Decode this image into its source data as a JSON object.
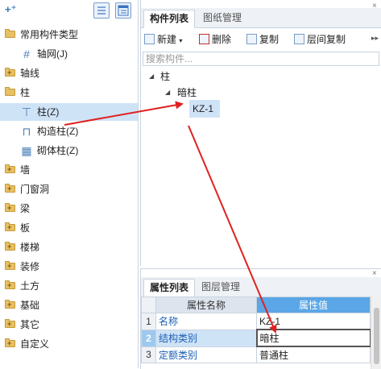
{
  "left_tree": {
    "items": [
      {
        "label": "常用构件类型",
        "kind": "folder",
        "expanded": true
      },
      {
        "label": "轴网(J)",
        "kind": "leaf",
        "icon": "grid-icon"
      },
      {
        "label": "轴线",
        "kind": "folder"
      },
      {
        "label": "柱",
        "kind": "folder",
        "expanded": true
      },
      {
        "label": "柱(Z)",
        "kind": "leaf",
        "icon": "column-icon",
        "selected": true
      },
      {
        "label": "构造柱(Z)",
        "kind": "leaf",
        "icon": "constructional-column-icon"
      },
      {
        "label": "砌体柱(Z)",
        "kind": "leaf",
        "icon": "masonry-column-icon"
      },
      {
        "label": "墙",
        "kind": "folder"
      },
      {
        "label": "门窗洞",
        "kind": "folder"
      },
      {
        "label": "梁",
        "kind": "folder"
      },
      {
        "label": "板",
        "kind": "folder"
      },
      {
        "label": "楼梯",
        "kind": "folder"
      },
      {
        "label": "装修",
        "kind": "folder"
      },
      {
        "label": "土方",
        "kind": "folder"
      },
      {
        "label": "基础",
        "kind": "folder"
      },
      {
        "label": "其它",
        "kind": "folder"
      },
      {
        "label": "自定义",
        "kind": "folder"
      }
    ]
  },
  "component_panel": {
    "tabs": [
      {
        "label": "构件列表"
      },
      {
        "label": "图纸管理"
      }
    ],
    "toolbar": {
      "new_label": "新建",
      "delete_label": "删除",
      "copy_label": "复制",
      "floor_copy_label": "层间复制"
    },
    "search_placeholder": "搜索构件...",
    "tree": {
      "root": "柱",
      "child": "暗柱",
      "leaf": "KZ-1"
    }
  },
  "property_panel": {
    "tabs": [
      {
        "label": "属性列表"
      },
      {
        "label": "图层管理"
      }
    ],
    "headers": {
      "name": "属性名称",
      "value": "属性值"
    },
    "rows": [
      {
        "num": "1",
        "name": "名称",
        "value": "KZ-1"
      },
      {
        "num": "2",
        "name": "结构类别",
        "value": "暗柱"
      },
      {
        "num": "3",
        "name": "定额类别",
        "value": "普通柱"
      }
    ]
  },
  "colors": {
    "accent": "#5aa6e6",
    "selection": "#cfe3f7",
    "arrow": "#e02020"
  }
}
